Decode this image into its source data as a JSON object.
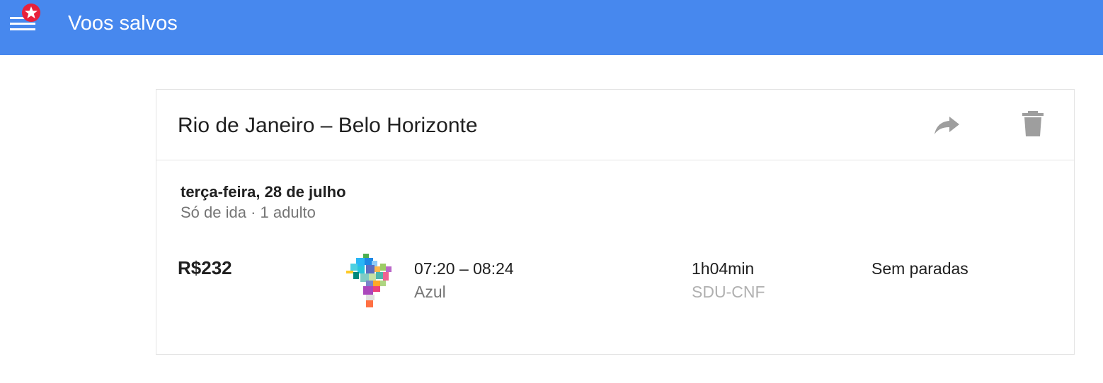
{
  "header": {
    "title": "Voos salvos",
    "menu_icon": "hamburger-menu-icon",
    "badge_icon": "star-badge-icon",
    "background_color": "#4788ee",
    "badge_color": "#e8213b"
  },
  "saved_flight": {
    "route": "Rio de Janeiro – Belo Horizonte",
    "actions": {
      "share_icon": "share-icon",
      "delete_icon": "trash-icon"
    },
    "date": "terça-feira, 28 de julho",
    "trip_info": "Só de ida · 1 adulto",
    "flight": {
      "price": "R$232",
      "times": "07:20 – 08:24",
      "airline": "Azul",
      "airline_logo_icon": "azul-brazil-map-logo",
      "duration": "1h04min",
      "airports": "SDU-CNF",
      "stops": "Sem paradas"
    }
  }
}
